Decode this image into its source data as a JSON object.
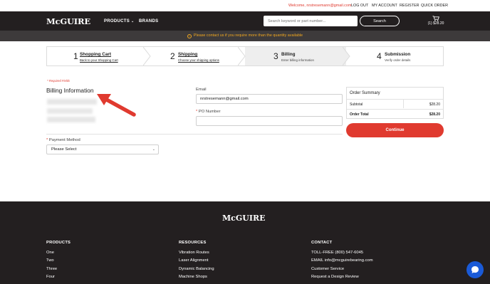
{
  "topbar": {
    "welcome": "Welcome, nrstresemann@gmail.com",
    "logout": "LOG OUT",
    "my_account": "MY ACCOUNT",
    "register": "REGISTER",
    "quick_order": "QUICK ORDER"
  },
  "header": {
    "logo": "McGUIRE",
    "nav_products": "PRODUCTS",
    "nav_brands": "BRANDS",
    "search_placeholder": "Search keyword or part number...",
    "search_button": "Search",
    "cart_summary": "(1) $28.20"
  },
  "notice": {
    "text": "Please contact us if you require more than the quantity available"
  },
  "steps": [
    {
      "num": "1",
      "title": "Shopping Cart",
      "sub": "Back to your Shopping Cart"
    },
    {
      "num": "2",
      "title": "Shipping",
      "sub": "Choose your shipping options"
    },
    {
      "num": "3",
      "title": "Billing",
      "sub": "Enter billing information"
    },
    {
      "num": "4",
      "title": "Submission",
      "sub": "Verify order details"
    }
  ],
  "form": {
    "required_note": "* Required Fields",
    "billing_title": "Billing Information",
    "email_label": "Email",
    "email_value": "nrstresemann@gmail.com",
    "po_label": "PO Number",
    "payment_label": "Payment Method",
    "payment_value": "Please Select"
  },
  "summary": {
    "title": "Order Summary",
    "subtotal_label": "Subtotal",
    "subtotal_value": "$28.20",
    "total_label": "Order Total",
    "total_value": "$28.20",
    "continue": "Continue"
  },
  "footer": {
    "logo": "McGUIRE",
    "products": {
      "heading": "PRODUCTS",
      "items": [
        "One",
        "Two",
        "Three",
        "Four"
      ]
    },
    "resources": {
      "heading": "RESOURCES",
      "items": [
        "Vibration Routes",
        "Laser Alignment",
        "Dynamic Balancing",
        "Machine Shops"
      ]
    },
    "contact": {
      "heading": "CONTACT",
      "items": [
        "TOLL-FREE (800) 547-6045",
        "EMAIL info@mcguirebearing.com",
        "Customer Service",
        "Request a Design Review"
      ]
    }
  },
  "colors": {
    "brand_red": "#e03a2f",
    "header_dark": "#231f20",
    "notice_orange": "#f0a71f",
    "chat_blue": "#1a5ad7"
  }
}
